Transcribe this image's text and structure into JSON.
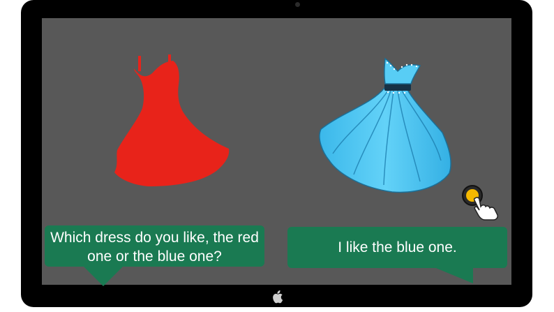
{
  "dialogue": {
    "question": "Which dress do you like, the red one or the blue one?",
    "answer": "I like the blue one."
  },
  "colors": {
    "bezel": "#000000",
    "screen": "#585858",
    "red_dress": "#e8231a",
    "blue_dress": "#4cc6f3",
    "bubble": "#1a7a52",
    "button": "#f5b800"
  },
  "icons": {
    "device_logo": "apple-logo-icon",
    "tap": "tap-hand-icon"
  }
}
